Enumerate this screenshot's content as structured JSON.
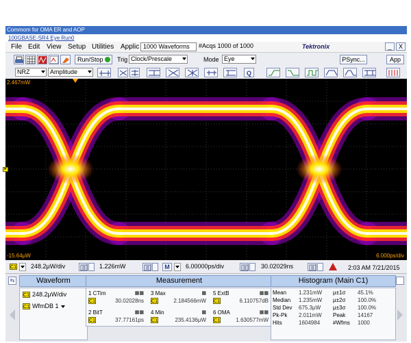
{
  "window": {
    "title": "Commom for OMA ER and AOP",
    "tab": "100GBASE-SR4 Eye Run0"
  },
  "menu": [
    "File",
    "Edit",
    "View",
    "Setup",
    "Utilities",
    "Applic"
  ],
  "window_controls": {
    "minimize": "_",
    "close": "X"
  },
  "acq": {
    "waveforms": "1000 Waveforms",
    "acqs": "#Acqs  1000 of 1000"
  },
  "brand": "Tektronix",
  "toolbar": {
    "run_stop": "Run/Stop",
    "trig_label": "Trig",
    "trig_value": "Clock/Prescale",
    "mode_label": "Mode",
    "mode_value": "Eye",
    "psync": "PSync...",
    "app": "App"
  },
  "toolbar2": {
    "coding": "NRZ",
    "scale": "Amplitude"
  },
  "scope": {
    "top_label": "2.467mW",
    "bottom_label": "-15.64μW",
    "time_div": "6.000ps/div",
    "eye_color_hot": "#ffffff",
    "eye_color_mid": "#ffe600",
    "eye_color_low": "#ff2a2a",
    "eye_color_edge": "#9a00c8"
  },
  "status": {
    "vert_scale": "248.2μW/div",
    "vert_offset": "1.226mW",
    "horiz_mode": "M",
    "horiz_scale": "6.00000ps/div",
    "horiz_pos": "30.02029ns",
    "time": "2:03 AM 7/21/2015"
  },
  "waveform": {
    "header": "Waveform",
    "items": [
      {
        "label": "248.2μW/div"
      },
      {
        "label": "WfmDB 1"
      }
    ]
  },
  "measurement": {
    "header": "Measurement",
    "cells": [
      {
        "name": "1 CTim",
        "value": "30.02028ns"
      },
      {
        "name": "3 Max",
        "value": "2.184566mW"
      },
      {
        "name": "5 ExtB",
        "value": "6.110757dB"
      },
      {
        "name": "2 BitT",
        "value": "37.77161ps"
      },
      {
        "name": "4 Min",
        "value": "235.4136μW"
      },
      {
        "name": "6 OMA",
        "value": "1.630577mW"
      }
    ]
  },
  "histogram": {
    "header": "Histogram (Main  C1)",
    "rows": [
      [
        "Mean",
        "1.231mW",
        "μ±1σ",
        "45.1%"
      ],
      [
        "Median",
        "1.235mW",
        "μ±2σ",
        "100.0%"
      ],
      [
        "Std Dev",
        "675.3μW",
        "μ±3σ",
        "100.0%"
      ],
      [
        "Pk-Pk",
        "2.011mW",
        "Peak",
        "14167"
      ],
      [
        "Hits",
        "1604984",
        "#Wfms",
        "1000"
      ]
    ]
  }
}
